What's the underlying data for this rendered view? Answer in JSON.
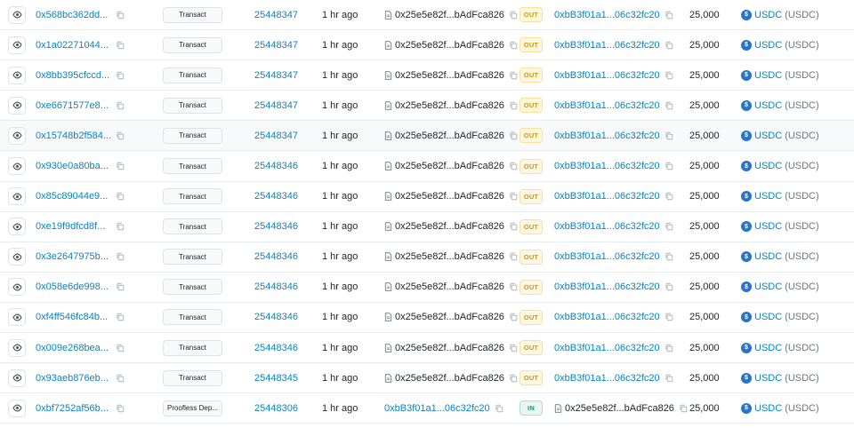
{
  "rows": [
    {
      "hash": "0x568bc362dd...",
      "method": "Transact",
      "block": "25448347",
      "age": "1 hr ago",
      "from": "0x25e5e82f...bAdFca826",
      "from_type": "contract",
      "direction": "OUT",
      "to": "0xbB3f01a1...06c32fc20",
      "to_type": "address",
      "amount": "25,000",
      "token": "USDC",
      "token_symbol": "(USDC)"
    },
    {
      "hash": "0x1a02271044...",
      "method": "Transact",
      "block": "25448347",
      "age": "1 hr ago",
      "from": "0x25e5e82f...bAdFca826",
      "from_type": "contract",
      "direction": "OUT",
      "to": "0xbB3f01a1...06c32fc20",
      "to_type": "address",
      "amount": "25,000",
      "token": "USDC",
      "token_symbol": "(USDC)"
    },
    {
      "hash": "0x8bb395cfccd...",
      "method": "Transact",
      "block": "25448347",
      "age": "1 hr ago",
      "from": "0x25e5e82f...bAdFca826",
      "from_type": "contract",
      "direction": "OUT",
      "to": "0xbB3f01a1...06c32fc20",
      "to_type": "address",
      "amount": "25,000",
      "token": "USDC",
      "token_symbol": "(USDC)"
    },
    {
      "hash": "0xe6671577e8...",
      "method": "Transact",
      "block": "25448347",
      "age": "1 hr ago",
      "from": "0x25e5e82f...bAdFca826",
      "from_type": "contract",
      "direction": "OUT",
      "to": "0xbB3f01a1...06c32fc20",
      "to_type": "address",
      "amount": "25,000",
      "token": "USDC",
      "token_symbol": "(USDC)"
    },
    {
      "hash": "0x15748b2f584...",
      "method": "Transact",
      "block": "25448347",
      "age": "1 hr ago",
      "from": "0x25e5e82f...bAdFca826",
      "from_type": "contract",
      "direction": "OUT",
      "to": "0xbB3f01a1...06c32fc20",
      "to_type": "address",
      "amount": "25,000",
      "token": "USDC",
      "token_symbol": "(USDC)"
    },
    {
      "hash": "0x930e0a80ba...",
      "method": "Transact",
      "block": "25448346",
      "age": "1 hr ago",
      "from": "0x25e5e82f...bAdFca826",
      "from_type": "contract",
      "direction": "OUT",
      "to": "0xbB3f01a1...06c32fc20",
      "to_type": "address",
      "amount": "25,000",
      "token": "USDC",
      "token_symbol": "(USDC)"
    },
    {
      "hash": "0x85c89044e9...",
      "method": "Transact",
      "block": "25448346",
      "age": "1 hr ago",
      "from": "0x25e5e82f...bAdFca826",
      "from_type": "contract",
      "direction": "OUT",
      "to": "0xbB3f01a1...06c32fc20",
      "to_type": "address",
      "amount": "25,000",
      "token": "USDC",
      "token_symbol": "(USDC)"
    },
    {
      "hash": "0xe19f9dfcd8f...",
      "method": "Transact",
      "block": "25448346",
      "age": "1 hr ago",
      "from": "0x25e5e82f...bAdFca826",
      "from_type": "contract",
      "direction": "OUT",
      "to": "0xbB3f01a1...06c32fc20",
      "to_type": "address",
      "amount": "25,000",
      "token": "USDC",
      "token_symbol": "(USDC)"
    },
    {
      "hash": "0x3e2647975b...",
      "method": "Transact",
      "block": "25448346",
      "age": "1 hr ago",
      "from": "0x25e5e82f...bAdFca826",
      "from_type": "contract",
      "direction": "OUT",
      "to": "0xbB3f01a1...06c32fc20",
      "to_type": "address",
      "amount": "25,000",
      "token": "USDC",
      "token_symbol": "(USDC)"
    },
    {
      "hash": "0x058e6de998...",
      "method": "Transact",
      "block": "25448346",
      "age": "1 hr ago",
      "from": "0x25e5e82f...bAdFca826",
      "from_type": "contract",
      "direction": "OUT",
      "to": "0xbB3f01a1...06c32fc20",
      "to_type": "address",
      "amount": "25,000",
      "token": "USDC",
      "token_symbol": "(USDC)"
    },
    {
      "hash": "0xf4ff546fc84b...",
      "method": "Transact",
      "block": "25448346",
      "age": "1 hr ago",
      "from": "0x25e5e82f...bAdFca826",
      "from_type": "contract",
      "direction": "OUT",
      "to": "0xbB3f01a1...06c32fc20",
      "to_type": "address",
      "amount": "25,000",
      "token": "USDC",
      "token_symbol": "(USDC)"
    },
    {
      "hash": "0x009e268bea...",
      "method": "Transact",
      "block": "25448346",
      "age": "1 hr ago",
      "from": "0x25e5e82f...bAdFca826",
      "from_type": "contract",
      "direction": "OUT",
      "to": "0xbB3f01a1...06c32fc20",
      "to_type": "address",
      "amount": "25,000",
      "token": "USDC",
      "token_symbol": "(USDC)"
    },
    {
      "hash": "0x93aeb876eb...",
      "method": "Transact",
      "block": "25448345",
      "age": "1 hr ago",
      "from": "0x25e5e82f...bAdFca826",
      "from_type": "contract",
      "direction": "OUT",
      "to": "0xbB3f01a1...06c32fc20",
      "to_type": "address",
      "amount": "25,000",
      "token": "USDC",
      "token_symbol": "(USDC)"
    },
    {
      "hash": "0xbf7252af56b...",
      "method": "Proofless Dep...",
      "block": "25448306",
      "age": "1 hr ago",
      "from": "0xbB3f01a1...06c32fc20",
      "from_type": "address",
      "direction": "IN",
      "to": "0x25e5e82f...bAdFca826",
      "to_type": "contract",
      "amount": "25,000",
      "token": "USDC",
      "token_symbol": "(USDC)"
    }
  ],
  "hover_row": 4,
  "colors": {
    "link": "#0784c3",
    "out": "#cc9a06",
    "in": "#00a186",
    "usdc": "#2775ca"
  },
  "icons": {
    "eye": "eye-icon",
    "copy": "copy-icon",
    "contract": "document-icon",
    "token": "usdc-token-icon"
  }
}
